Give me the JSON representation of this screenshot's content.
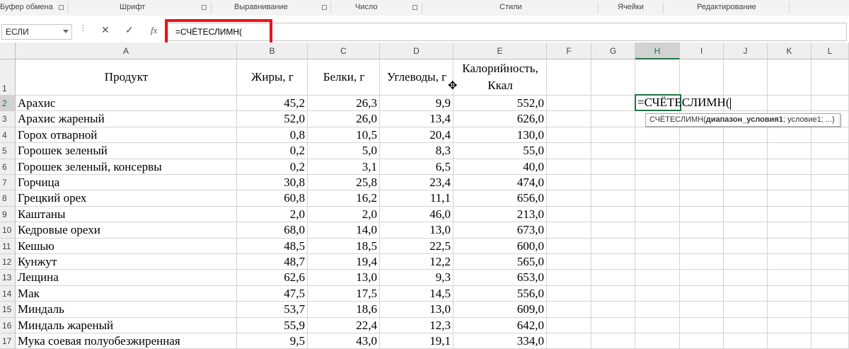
{
  "ribbon": {
    "groups": [
      "Буфер обмена",
      "Шрифт",
      "Выравнивание",
      "Число",
      "Стили",
      "Ячейки",
      "Редактирование"
    ]
  },
  "formula_bar": {
    "name_box": "ЕСЛИ",
    "cancel_icon": "✕",
    "enter_icon": "✓",
    "fx_label": "fx",
    "formula": "=СЧЁТЕСЛИМН("
  },
  "columns": [
    "A",
    "B",
    "C",
    "D",
    "E",
    "F",
    "G",
    "H",
    "I",
    "J",
    "K",
    "L"
  ],
  "header_row": {
    "row_number": "1",
    "product": "Продукт",
    "fat": "Жиры, г",
    "protein": "Белки, г",
    "carbs": "Углеводы, г",
    "calories_line1": "Калорийность,",
    "calories_line2": "Ккал"
  },
  "rows": [
    {
      "n": "2",
      "product": "Арахис",
      "fat": "45,2",
      "protein": "26,3",
      "carbs": "9,9",
      "kcal": "552,0"
    },
    {
      "n": "3",
      "product": "Арахис жареный",
      "fat": "52,0",
      "protein": "26,0",
      "carbs": "13,4",
      "kcal": "626,0"
    },
    {
      "n": "4",
      "product": "Горох отварной",
      "fat": "0,8",
      "protein": "10,5",
      "carbs": "20,4",
      "kcal": "130,0"
    },
    {
      "n": "5",
      "product": "Горошек зеленый",
      "fat": "0,2",
      "protein": "5,0",
      "carbs": "8,3",
      "kcal": "55,0"
    },
    {
      "n": "6",
      "product": "Горошек зеленый, консервы",
      "fat": "0,2",
      "protein": "3,1",
      "carbs": "6,5",
      "kcal": "40,0"
    },
    {
      "n": "7",
      "product": "Горчица",
      "fat": "30,8",
      "protein": "25,8",
      "carbs": "23,4",
      "kcal": "474,0"
    },
    {
      "n": "8",
      "product": "Грецкий орех",
      "fat": "60,8",
      "protein": "16,2",
      "carbs": "11,1",
      "kcal": "656,0"
    },
    {
      "n": "9",
      "product": "Каштаны",
      "fat": "2,0",
      "protein": "2,0",
      "carbs": "46,0",
      "kcal": "213,0"
    },
    {
      "n": "10",
      "product": "Кедровые орехи",
      "fat": "68,0",
      "protein": "14,0",
      "carbs": "13,0",
      "kcal": "673,0"
    },
    {
      "n": "11",
      "product": "Кешью",
      "fat": "48,5",
      "protein": "18,5",
      "carbs": "22,5",
      "kcal": "600,0"
    },
    {
      "n": "12",
      "product": "Кунжут",
      "fat": "48,7",
      "protein": "19,4",
      "carbs": "12,2",
      "kcal": "565,0"
    },
    {
      "n": "13",
      "product": "Лещина",
      "fat": "62,6",
      "protein": "13,0",
      "carbs": "9,3",
      "kcal": "653,0"
    },
    {
      "n": "14",
      "product": "Мак",
      "fat": "47,5",
      "protein": "17,5",
      "carbs": "14,5",
      "kcal": "556,0"
    },
    {
      "n": "15",
      "product": "Миндаль",
      "fat": "53,7",
      "protein": "18,6",
      "carbs": "13,0",
      "kcal": "609,0"
    },
    {
      "n": "16",
      "product": "Миндаль жареный",
      "fat": "55,9",
      "protein": "22,4",
      "carbs": "12,3",
      "kcal": "642,0"
    },
    {
      "n": "17",
      "product": "Мука соевая полуобезжиренная",
      "fat": "9,5",
      "protein": "43,0",
      "carbs": "19,1",
      "kcal": "334,0"
    }
  ],
  "active_cell": {
    "text": "=СЧЁТЕСЛИМН(",
    "tooltip_fn": "СЧЁТЕСЛИМН(",
    "tooltip_arg1": "диапазон_условия1",
    "tooltip_rest": "; условие1; ...)"
  }
}
